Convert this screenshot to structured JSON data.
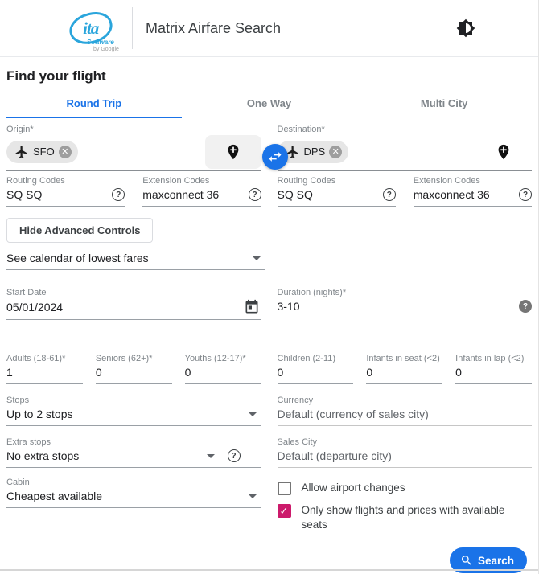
{
  "colors": {
    "accent": "#1a73e8",
    "pink": "#cc1a6b",
    "logo": "#2aa5dc"
  },
  "header": {
    "logo_ita": "ita",
    "logo_software": "Software",
    "logo_by_google": "by Google",
    "title": "Matrix Airfare Search"
  },
  "page": {
    "heading": "Find your flight"
  },
  "tabs": [
    {
      "label": "Round Trip"
    },
    {
      "label": "One Way"
    },
    {
      "label": "Multi City"
    }
  ],
  "route": {
    "origin_label": "Origin*",
    "origin_chip": "SFO",
    "destination_label": "Destination*",
    "destination_chip": "DPS"
  },
  "codes": {
    "outbound_routing_label": "Routing Codes",
    "outbound_routing_value": "SQ SQ",
    "outbound_extension_label": "Extension Codes",
    "outbound_extension_value": "maxconnect 36",
    "return_routing_label": "Routing Codes",
    "return_routing_value": "SQ SQ",
    "return_extension_label": "Extension Codes",
    "return_extension_value": "maxconnect 36"
  },
  "advanced_button_label": "Hide Advanced Controls",
  "calendar_select_value": "See calendar of lowest fares",
  "dates": {
    "start_label": "Start Date",
    "start_value": "05/01/2024",
    "duration_label": "Duration (nights)*",
    "duration_value": "3-10"
  },
  "passengers": [
    {
      "label": "Adults (18-61)*",
      "value": "1"
    },
    {
      "label": "Seniors (62+)*",
      "value": "0"
    },
    {
      "label": "Youths (12-17)*",
      "value": "0"
    },
    {
      "label": "Children (2-11)",
      "value": "0"
    },
    {
      "label": "Infants in seat (<2)",
      "value": "0"
    },
    {
      "label": "Infants in lap (<2)",
      "value": "0"
    }
  ],
  "options": {
    "stops_label": "Stops",
    "stops_value": "Up to 2 stops",
    "currency_label": "Currency",
    "currency_value": "Default (currency of sales city)",
    "extra_stops_label": "Extra stops",
    "extra_stops_value": "No extra stops",
    "sales_city_label": "Sales City",
    "sales_city_value": "Default (departure city)",
    "cabin_label": "Cabin",
    "cabin_value": "Cheapest available"
  },
  "checkboxes": [
    {
      "label": "Allow airport changes",
      "checked": false
    },
    {
      "label": "Only show flights and prices with available seats",
      "checked": true
    }
  ],
  "search_button_label": "Search"
}
